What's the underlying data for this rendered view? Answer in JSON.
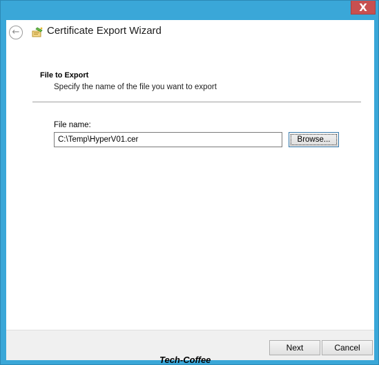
{
  "window": {
    "close_glyph": "X"
  },
  "header": {
    "back_glyph": "←",
    "title": "Certificate Export Wizard",
    "icon": "certificate-wizard-icon"
  },
  "page": {
    "section_title": "File to Export",
    "section_description": "Specify the name of the file you want to export",
    "file_label": "File name:",
    "file_value": "C:\\Temp\\HyperV01.cer",
    "browse_label": "Browse..."
  },
  "footer": {
    "next_label": "Next",
    "cancel_label": "Cancel"
  },
  "watermark": "Tech-Coffee",
  "colors": {
    "frame": "#3aa7d8",
    "close": "#c75050"
  }
}
